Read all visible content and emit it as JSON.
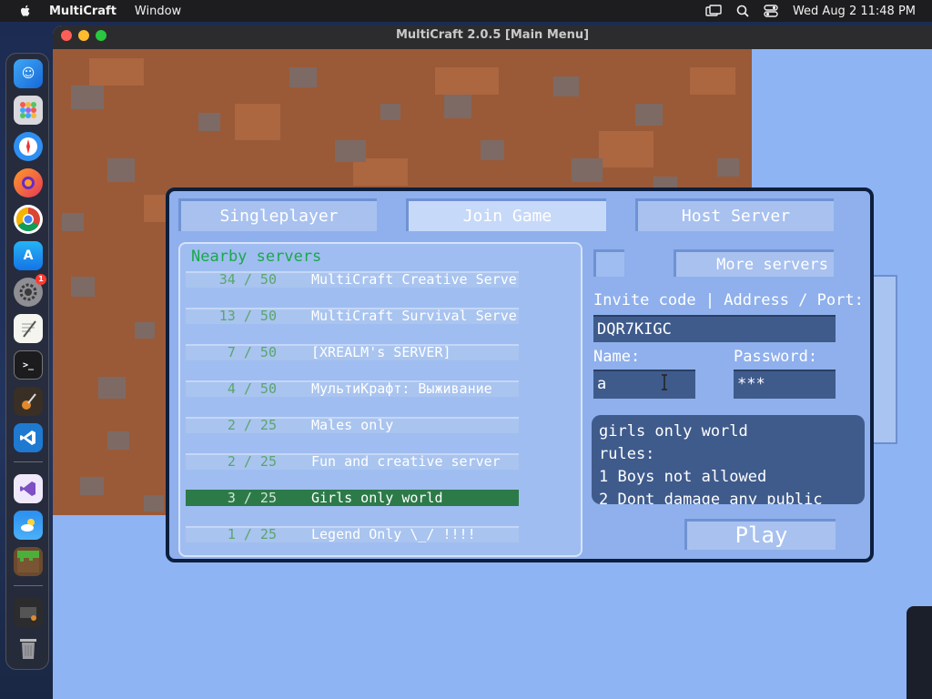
{
  "menubar": {
    "app_name": "MultiCraft",
    "menu_window": "Window",
    "datetime": "Wed Aug 2  11:48 PM"
  },
  "window": {
    "title": "MultiCraft 2.0.5 [Main Menu]"
  },
  "dock": {
    "badge_settings": "1"
  },
  "tabs": {
    "singleplayer": "Singleplayer",
    "join_game": "Join Game",
    "host_server": "Host Server",
    "active": "join_game"
  },
  "servers": {
    "heading": "Nearby servers",
    "rows": [
      {
        "count": "34 / 50",
        "name": "MultiCraft Creative Serve"
      },
      {
        "count": "13 / 50",
        "name": "MultiCraft Survival Server"
      },
      {
        "count": "7 / 50",
        "name": "[XREALM's SERVER]"
      },
      {
        "count": "4 / 50",
        "name": "МультиКрафт: Выживание"
      },
      {
        "count": "2 / 25",
        "name": "Males only"
      },
      {
        "count": "2 / 25",
        "name": "Fun and creative server"
      },
      {
        "count": "3 / 25",
        "name": "Girls only world"
      },
      {
        "count": "1 / 25",
        "name": "Legend Only \\_/ !!!!"
      }
    ],
    "selected_index": 6
  },
  "connect": {
    "more_servers": "More servers",
    "address_label": "Invite code | Address / Port:",
    "address_value": "DQR7KIGC",
    "name_label": "Name:",
    "name_value": "a",
    "password_label": "Password:",
    "password_value": "***",
    "description_lines": [
      "girls only world",
      "rules:",
      "1 Boys not allowed",
      "2 Dont damage any public"
    ],
    "play": "Play"
  },
  "colors": {
    "selected_row": "#2d7a49",
    "heading_green": "#1aa84a",
    "panel_blue": "#8fb0ec"
  }
}
